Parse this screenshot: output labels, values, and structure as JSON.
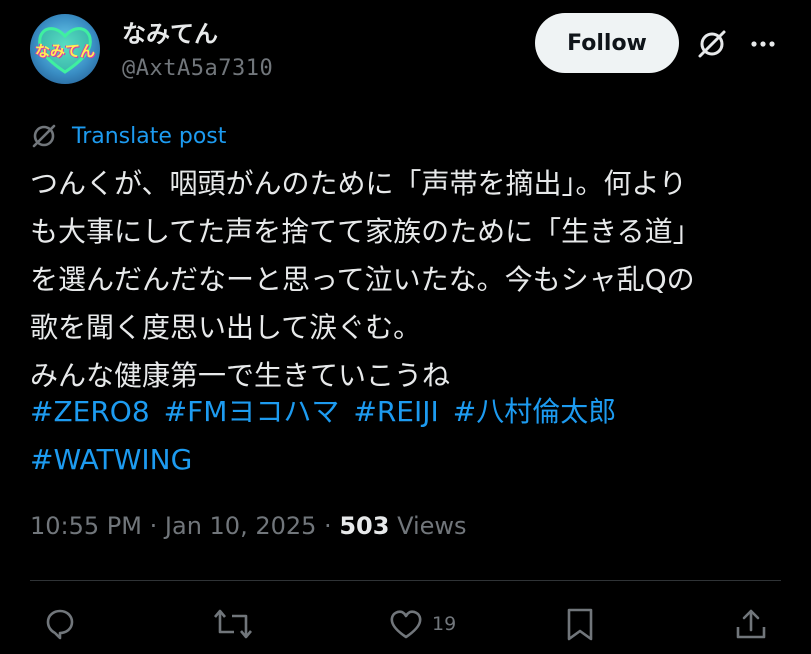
{
  "user": {
    "avatar_text": "なみてん",
    "display_name": "なみてん",
    "handle": "@AxtA5a7310"
  },
  "header": {
    "follow_label": "Follow",
    "grok_icon": "grok-icon",
    "more_icon": "more-icon"
  },
  "translate": {
    "label": "Translate post",
    "icon": "translate-icon"
  },
  "post": {
    "lines": [
      "つんくが、咽頭がんのために「声帯を摘出」。何より",
      "も大事にしてた声を捨てて家族のために「生きる道」",
      "を選んだんだなーと思って泣いたな。今もシャ乱Qの",
      "歌を聞く度思い出して涙ぐむ。",
      "みんな健康第一で生きていこうね"
    ],
    "hashtags_line1": [
      "#ZERO8",
      "#FMヨコハマ",
      "#REIJI",
      "#八村倫太郎"
    ],
    "hashtags_line2": [
      "#WATWING"
    ]
  },
  "meta": {
    "time": "10:55 PM",
    "separator": "·",
    "date": "Jan 10, 2025",
    "views_count": "503",
    "views_label": "Views"
  },
  "actions": {
    "reply_count": "",
    "repost_count": "",
    "like_count": "19",
    "bookmark_count": "",
    "icons": [
      "reply-icon",
      "repost-icon",
      "like-icon",
      "bookmark-icon",
      "share-icon"
    ]
  },
  "colors": {
    "background": "#000000",
    "text": "#e7e9ea",
    "secondary": "#71767b",
    "accent": "#1d9bf0",
    "divider": "#2f3336",
    "button_bg": "#eff3f4"
  }
}
